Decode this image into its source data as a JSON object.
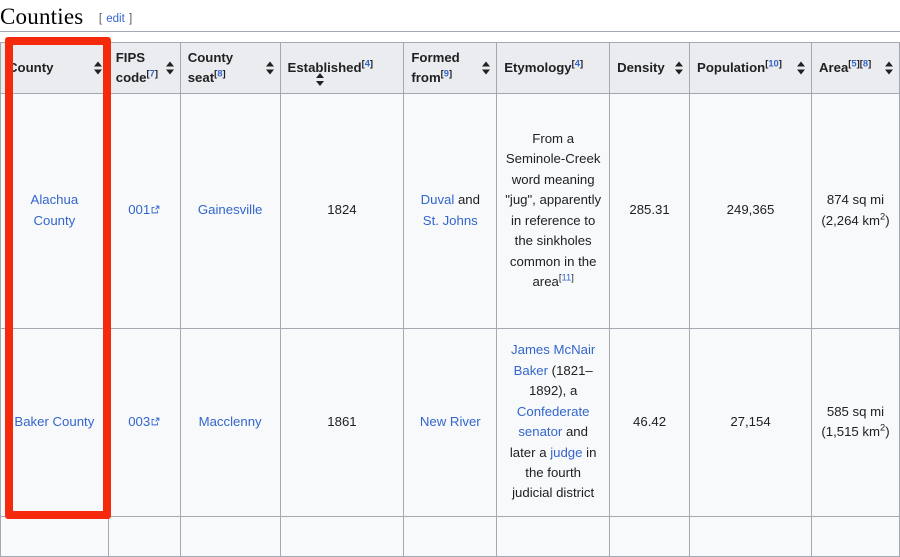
{
  "section": {
    "title": "Counties",
    "edit": {
      "open_bracket": "[",
      "label": "edit",
      "close_bracket": "]"
    }
  },
  "table": {
    "columns": [
      {
        "label": "County",
        "refs": [],
        "sortable": true,
        "arrow": "right"
      },
      {
        "label": "FIPS code",
        "refs": [
          "7"
        ],
        "sortable": true,
        "arrow": "right"
      },
      {
        "label": "County seat",
        "refs": [
          "8"
        ],
        "sortable": true,
        "arrow": "right"
      },
      {
        "label": "Established",
        "refs": [
          "4"
        ],
        "sortable": true,
        "arrow": "below"
      },
      {
        "label": "Formed from",
        "refs": [
          "9"
        ],
        "sortable": true,
        "arrow": "right"
      },
      {
        "label": "Etymology",
        "refs": [
          "4"
        ],
        "sortable": false,
        "arrow": "none"
      },
      {
        "label": "Density",
        "refs": [],
        "sortable": true,
        "arrow": "right"
      },
      {
        "label": "Population",
        "refs": [
          "10"
        ],
        "sortable": true,
        "arrow": "right"
      },
      {
        "label": "Area",
        "refs": [
          "5",
          "8"
        ],
        "sortable": true,
        "arrow": "right"
      }
    ],
    "rows": [
      {
        "county": "Alachua County",
        "fips": "001",
        "seat": "Gainesville",
        "established": "1824",
        "formed_from": [
          {
            "text": "Duval",
            "link": true
          },
          {
            "text": " and ",
            "link": false
          },
          {
            "text": "St. Johns",
            "link": true
          }
        ],
        "etymology": [
          {
            "text": "From a Seminole-Creek word meaning \"jug\", apparently in reference to the sinkholes common in the area",
            "link": false
          }
        ],
        "etymology_ref": "11",
        "density": "285.31",
        "population": "249,365",
        "area_imperial": "874 sq mi",
        "area_metric_open": "(2,264 km",
        "area_metric_exp": "2",
        "area_metric_close": ")"
      },
      {
        "county": "Baker County",
        "fips": "003",
        "seat": "Macclenny",
        "established": "1861",
        "formed_from": [
          {
            "text": "New River",
            "link": true
          }
        ],
        "etymology": [
          {
            "text": "James McNair Baker",
            "link": true
          },
          {
            "text": " (1821–1892), a ",
            "link": false
          },
          {
            "text": "Confederate senator",
            "link": true
          },
          {
            "text": " and later a ",
            "link": false
          },
          {
            "text": "judge",
            "link": true
          },
          {
            "text": " in the fourth judicial district",
            "link": false
          }
        ],
        "etymology_ref": "",
        "density": "46.42",
        "population": "27,154",
        "area_imperial": "585 sq mi",
        "area_metric_open": "(1,515 km",
        "area_metric_exp": "2",
        "area_metric_close": ")"
      }
    ]
  },
  "annotation": {
    "highlight_color": "#f52a0c",
    "target_column": "County"
  },
  "colors": {
    "link": "#3366cc",
    "header_bg": "#eaecf0",
    "cell_bg": "#f8f9fa",
    "border": "#a2a9b1",
    "text": "#202122"
  }
}
